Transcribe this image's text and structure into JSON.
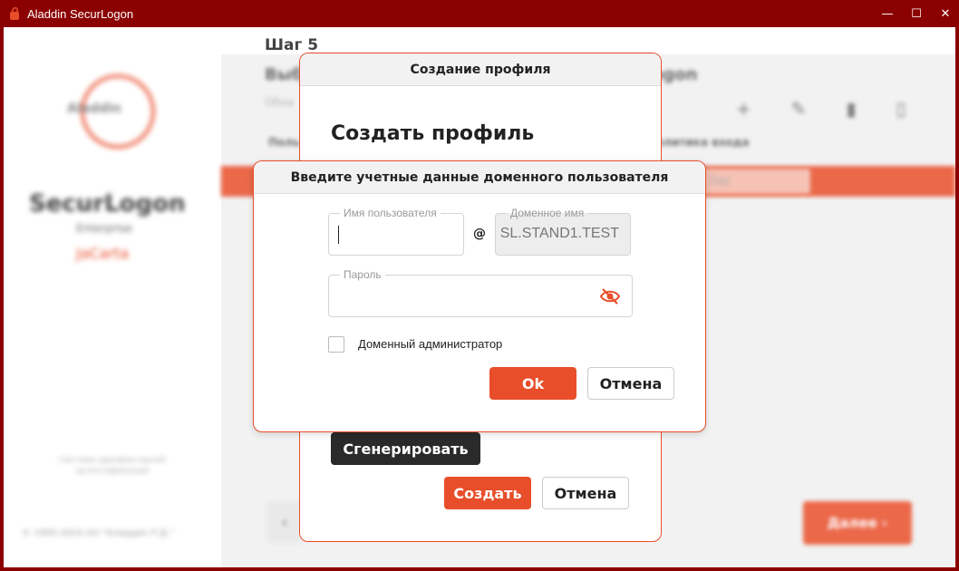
{
  "window": {
    "title": "Aladdin SecurLogon",
    "controls": {
      "minimize": "—",
      "maximize": "☐",
      "close": "✕"
    }
  },
  "background": {
    "sidebar": {
      "logo_text": "Aladdin",
      "brand": "SecurLogon",
      "edition": "Enterprise",
      "tag": "JaCarta",
      "note": "Система двухфакторной аутентификации",
      "copyright": "© 1995-2024 АО \"Аладдин Р.Д.\""
    },
    "step_title": "Шаг 5",
    "heading_left": "Выб",
    "heading_right": "ogon",
    "subheading": "Обна",
    "column_left": "Поль",
    "column_right": "олитика входа",
    "row_select": "Day",
    "back_label": "‹",
    "next_label": "Далее ›",
    "toolbar_icons": [
      "plus-icon",
      "pencil-icon",
      "trash-icon",
      "token-icon"
    ]
  },
  "dialog_profile": {
    "header": "Создание профиля",
    "title": "Создать профиль",
    "generate_label": "Сгенерировать",
    "create_label": "Создать",
    "cancel_label": "Отмена"
  },
  "dialog_credentials": {
    "header": "Введите учетные данные доменного пользователя",
    "username_legend": "Имя пользователя",
    "username_value": "",
    "at_sign": "@",
    "domain_legend": "Доменное имя",
    "domain_value": "SL.STAND1.TEST",
    "password_legend": "Пароль",
    "password_value": "",
    "checkbox_label": "Доменный администратор",
    "checkbox_checked": false,
    "ok_label": "Ok",
    "cancel_label": "Отмена"
  },
  "colors": {
    "frame": "#8b0000",
    "accent": "#e84e2a",
    "dark_button": "#2a2a2a"
  }
}
